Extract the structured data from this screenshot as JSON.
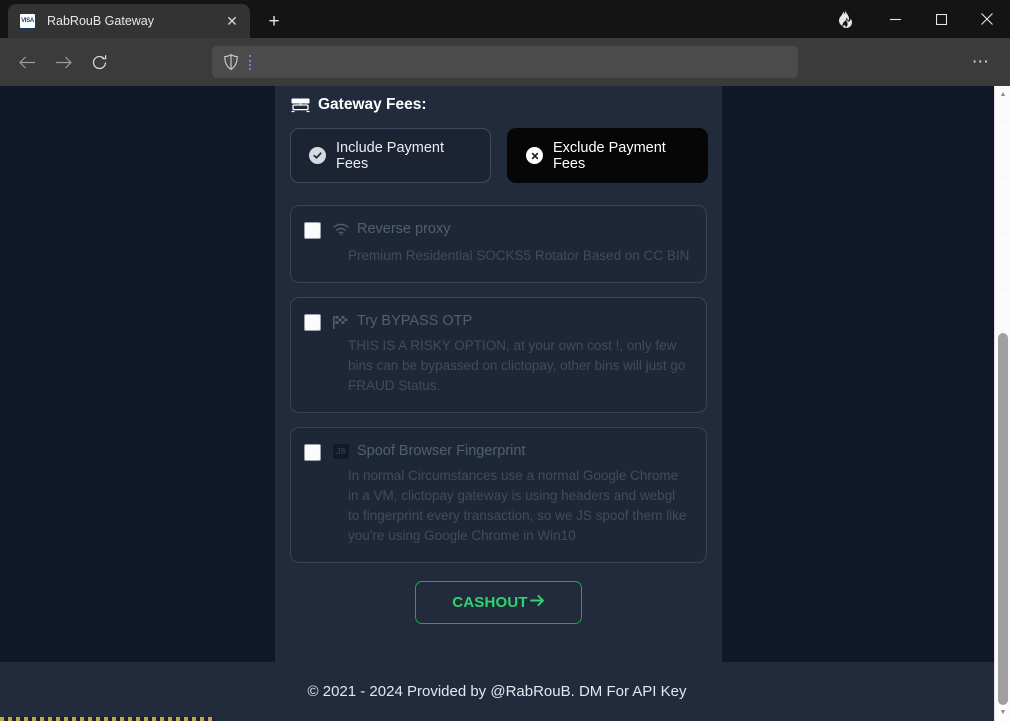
{
  "browser": {
    "tab": {
      "title": "RabRouB Gateway",
      "favicon": "visa-favicon",
      "close_label": "✕"
    },
    "new_tab_label": "+",
    "window_controls": {
      "minimize": "—",
      "maximize": "☐",
      "close": "✕",
      "flame": "flame-icon"
    },
    "nav": {
      "back": "←",
      "forward": "→",
      "reload": "⟳"
    },
    "omnibox": {
      "value": "",
      "placeholder": "",
      "shield": "shield-icon"
    },
    "menu": "⋯"
  },
  "page": {
    "gateway_fees": {
      "icon": "money-bill-icon",
      "title": "Gateway Fees:",
      "include_label": "Include Payment Fees",
      "include_icon": "check-circle-icon",
      "exclude_label": "Exclude Payment Fees",
      "exclude_icon": "x-circle-icon",
      "selected": "Exclude Payment Fees"
    },
    "options": [
      {
        "id": "reverse-proxy",
        "icon": "wifi-icon",
        "label": "Reverse proxy",
        "desc": "Premium Residential SOCKS5 Rotator Based on CC BIN",
        "checked": false
      },
      {
        "id": "bypass-otp",
        "icon": "checkered-flag-icon",
        "label": "Try BYPASS OTP",
        "desc": "THIS IS A RISKY OPTION, at your own cost !, only few bins can be bypassed on clictopay, other bins will just go FRAUD Status.",
        "checked": false
      },
      {
        "id": "spoof-fingerprint",
        "icon": "js-badge-icon",
        "icon_text": "JS",
        "label": "Spoof Browser Fingerprint",
        "desc": "In normal Circumstances use a normal Google Chrome in a VM, clictopay gateway is using headers and webgl to fingerprint every transaction, so we JS spoof them like you're using Google Chrome in Win10",
        "checked": false
      }
    ],
    "cashout_label": "CASHOUT",
    "cashout_icon": "arrow-right-icon",
    "footer_text": "© 2021 - 2024 Provided by @RabRouB. DM For API Key"
  },
  "scrollbar": {
    "up": "▲",
    "down": "▼"
  },
  "colors": {
    "page_bg": "#101828",
    "card_bg": "#222b3c",
    "accent_green": "#2fd46f",
    "muted_text": "#3f4c5f"
  }
}
